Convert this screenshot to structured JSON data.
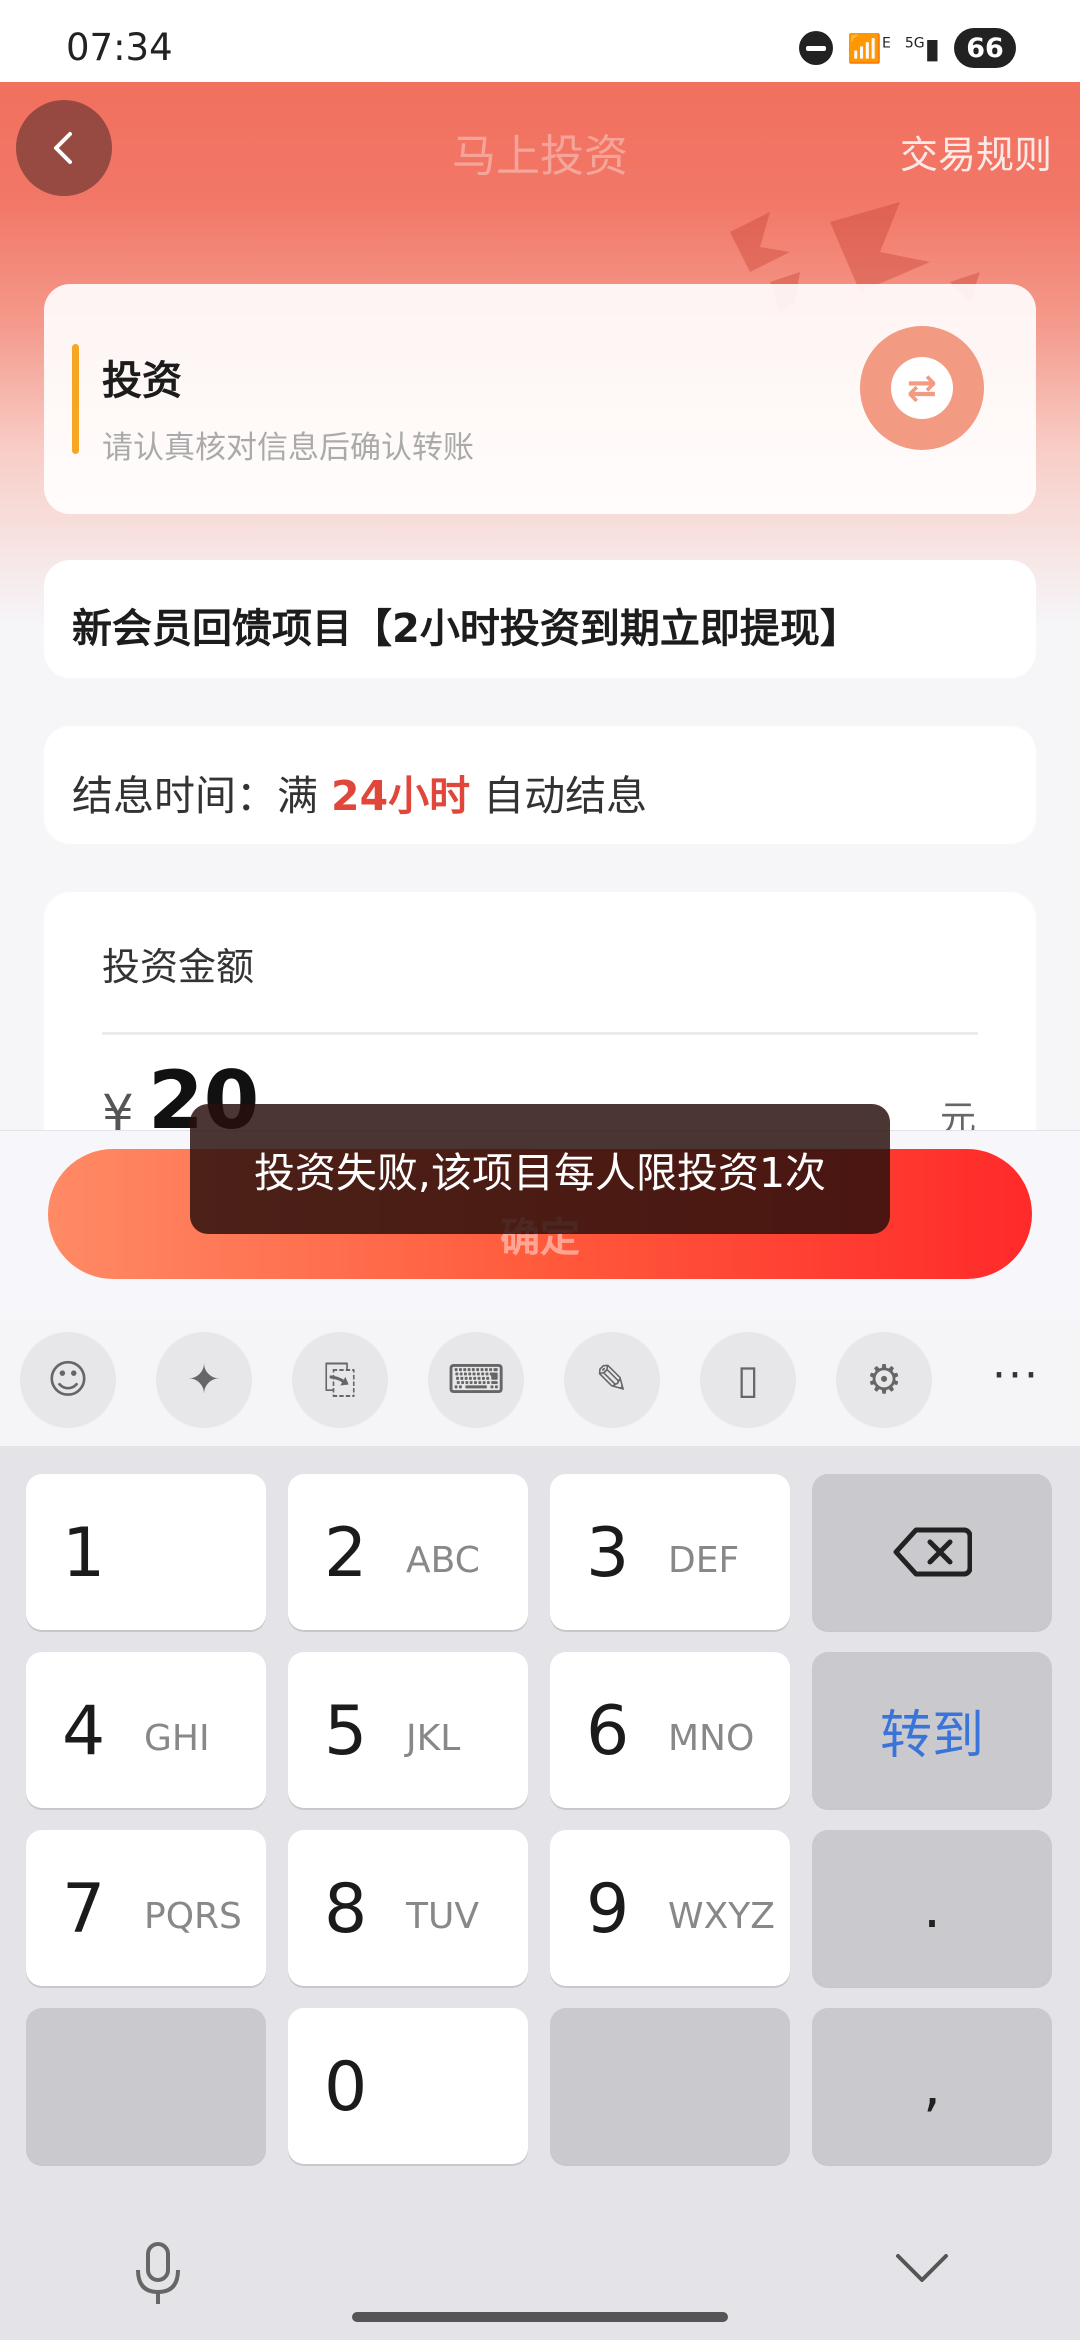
{
  "status_bar": {
    "time": "07:34",
    "wifi_label": "E",
    "signal_label": "5G",
    "battery": "66"
  },
  "nav": {
    "title": "马上投资",
    "rules": "交易规则"
  },
  "invest_card": {
    "title": "投资",
    "subtitle": "请认真核对信息后确认转账"
  },
  "project": {
    "name": "新会员回馈项目【2小时投资到期立即提现】"
  },
  "interest": {
    "prefix": "结息时间：满",
    "highlight": "24小时",
    "suffix": "自动结息"
  },
  "amount": {
    "label": "投资金额",
    "currency": "¥",
    "value": "20",
    "unit": "元"
  },
  "confirm": {
    "label": "确定"
  },
  "toast": {
    "message": "投资失败,该项目每人限投资1次"
  },
  "keyboard_toolbar": [
    "emoji-icon",
    "sparkle-icon",
    "translate-icon",
    "keyboard-icon",
    "handwriting-icon",
    "clipboard-icon",
    "gear-icon"
  ],
  "keyboard": {
    "keys": [
      {
        "num": "1",
        "letters": ""
      },
      {
        "num": "2",
        "letters": "ABC"
      },
      {
        "num": "3",
        "letters": "DEF"
      },
      {
        "num": "4",
        "letters": "GHI"
      },
      {
        "num": "5",
        "letters": "JKL"
      },
      {
        "num": "6",
        "letters": "MNO"
      },
      {
        "num": "7",
        "letters": "PQRS"
      },
      {
        "num": "8",
        "letters": "TUV"
      },
      {
        "num": "9",
        "letters": "WXYZ"
      },
      {
        "num": "0",
        "letters": ""
      }
    ],
    "goto": "转到",
    "dot": ".",
    "comma": ","
  },
  "colors": {
    "accent": "#e0473a",
    "header": "#f1705e",
    "button_start": "#ff8a65",
    "button_end": "#ff2a2a",
    "goto": "#3a74d8"
  }
}
